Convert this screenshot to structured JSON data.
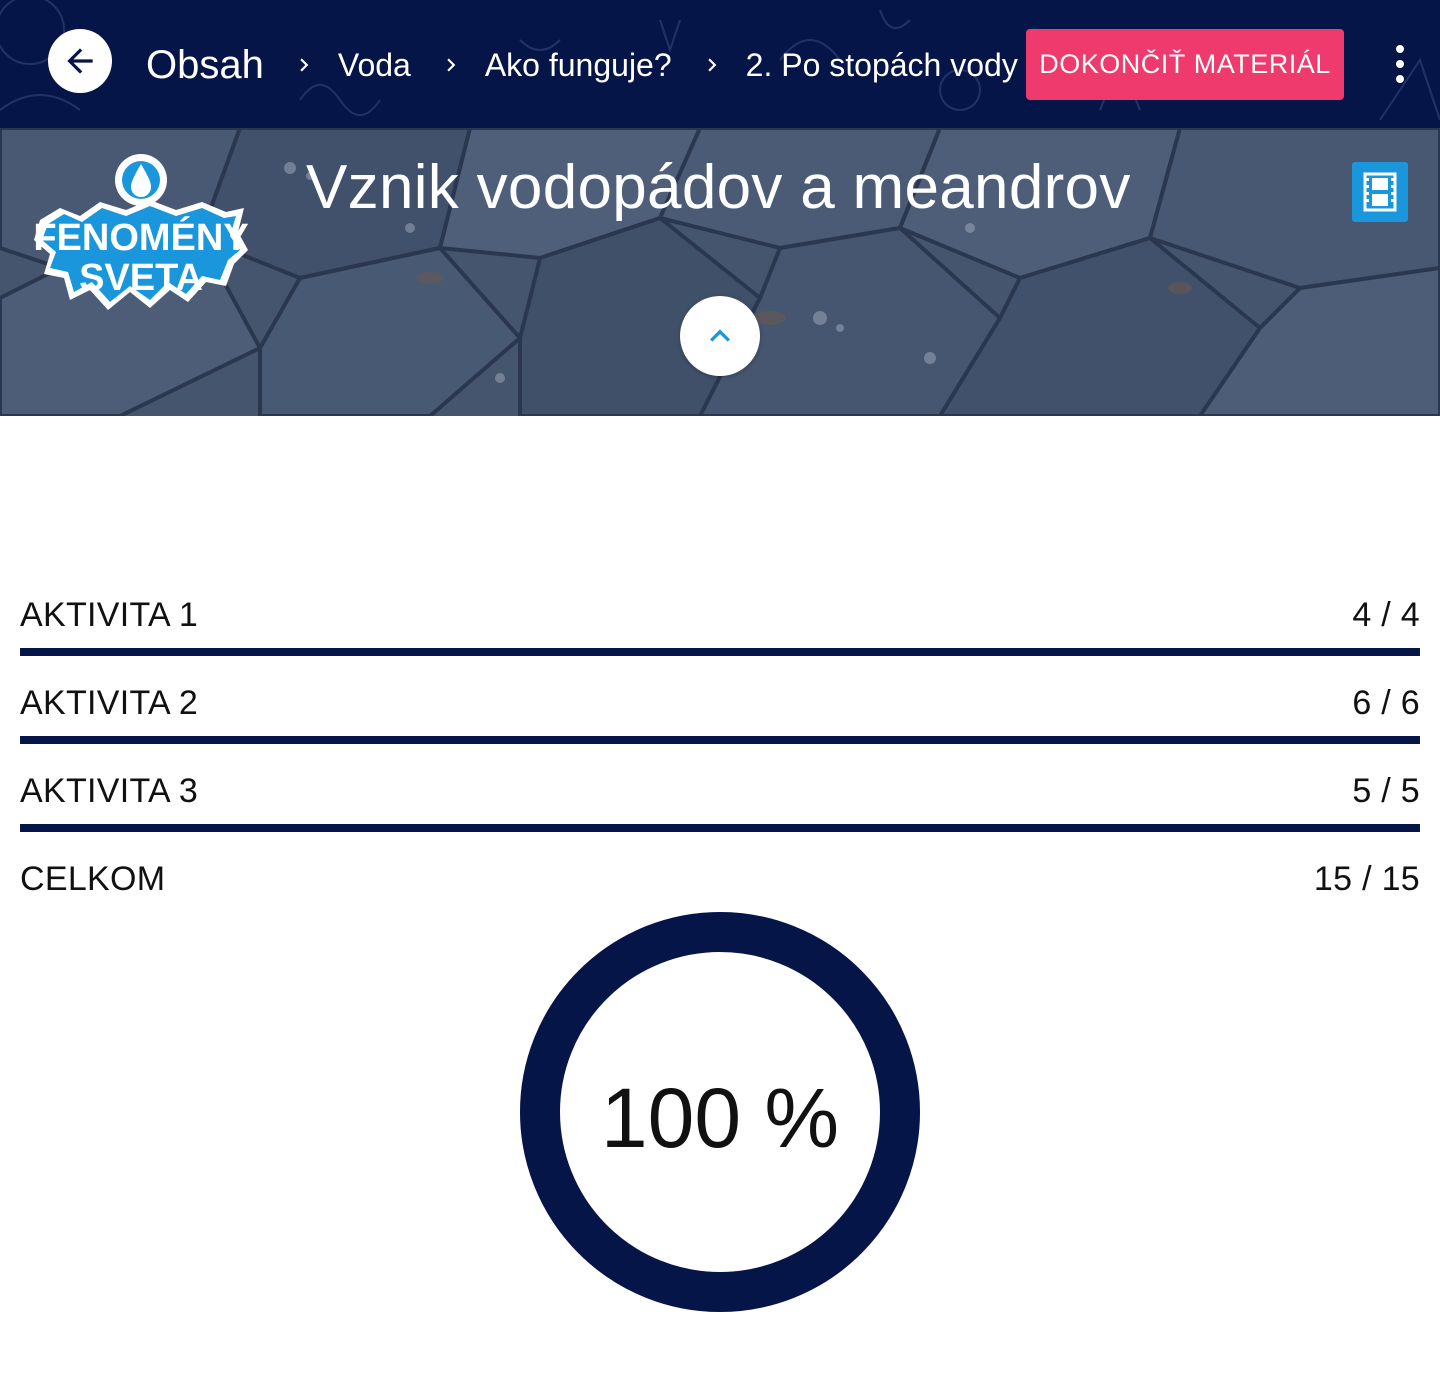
{
  "header": {
    "back_icon": "arrow-left-icon",
    "home_label": "Obsah",
    "breadcrumbs": [
      "Voda",
      "Ako funguje?",
      "2. Po stopách vody v…"
    ],
    "finish_label": "DOKONČIŤ MATERIÁL",
    "more_icon": "more-vertical-icon",
    "colors": {
      "bar": "#061548",
      "accent": "#ee3a6c"
    }
  },
  "hero": {
    "logo_line1": "FENOMÉNY",
    "logo_line2": "SVETA",
    "title": "Vznik vodopádov a meandrov",
    "media_icon": "film-icon",
    "collapse_icon": "chevron-up-icon"
  },
  "results": {
    "rows": [
      {
        "label": "AKTIVITA 1",
        "score": "4 / 4",
        "fraction": 1.0
      },
      {
        "label": "AKTIVITA 2",
        "score": "6 / 6",
        "fraction": 1.0
      },
      {
        "label": "AKTIVITA 3",
        "score": "5 / 5",
        "fraction": 1.0
      }
    ],
    "total": {
      "label": "CELKOM",
      "score": "15 / 15"
    },
    "percent_label": "100 %",
    "percent_value": 100,
    "ring_color": "#061548"
  }
}
